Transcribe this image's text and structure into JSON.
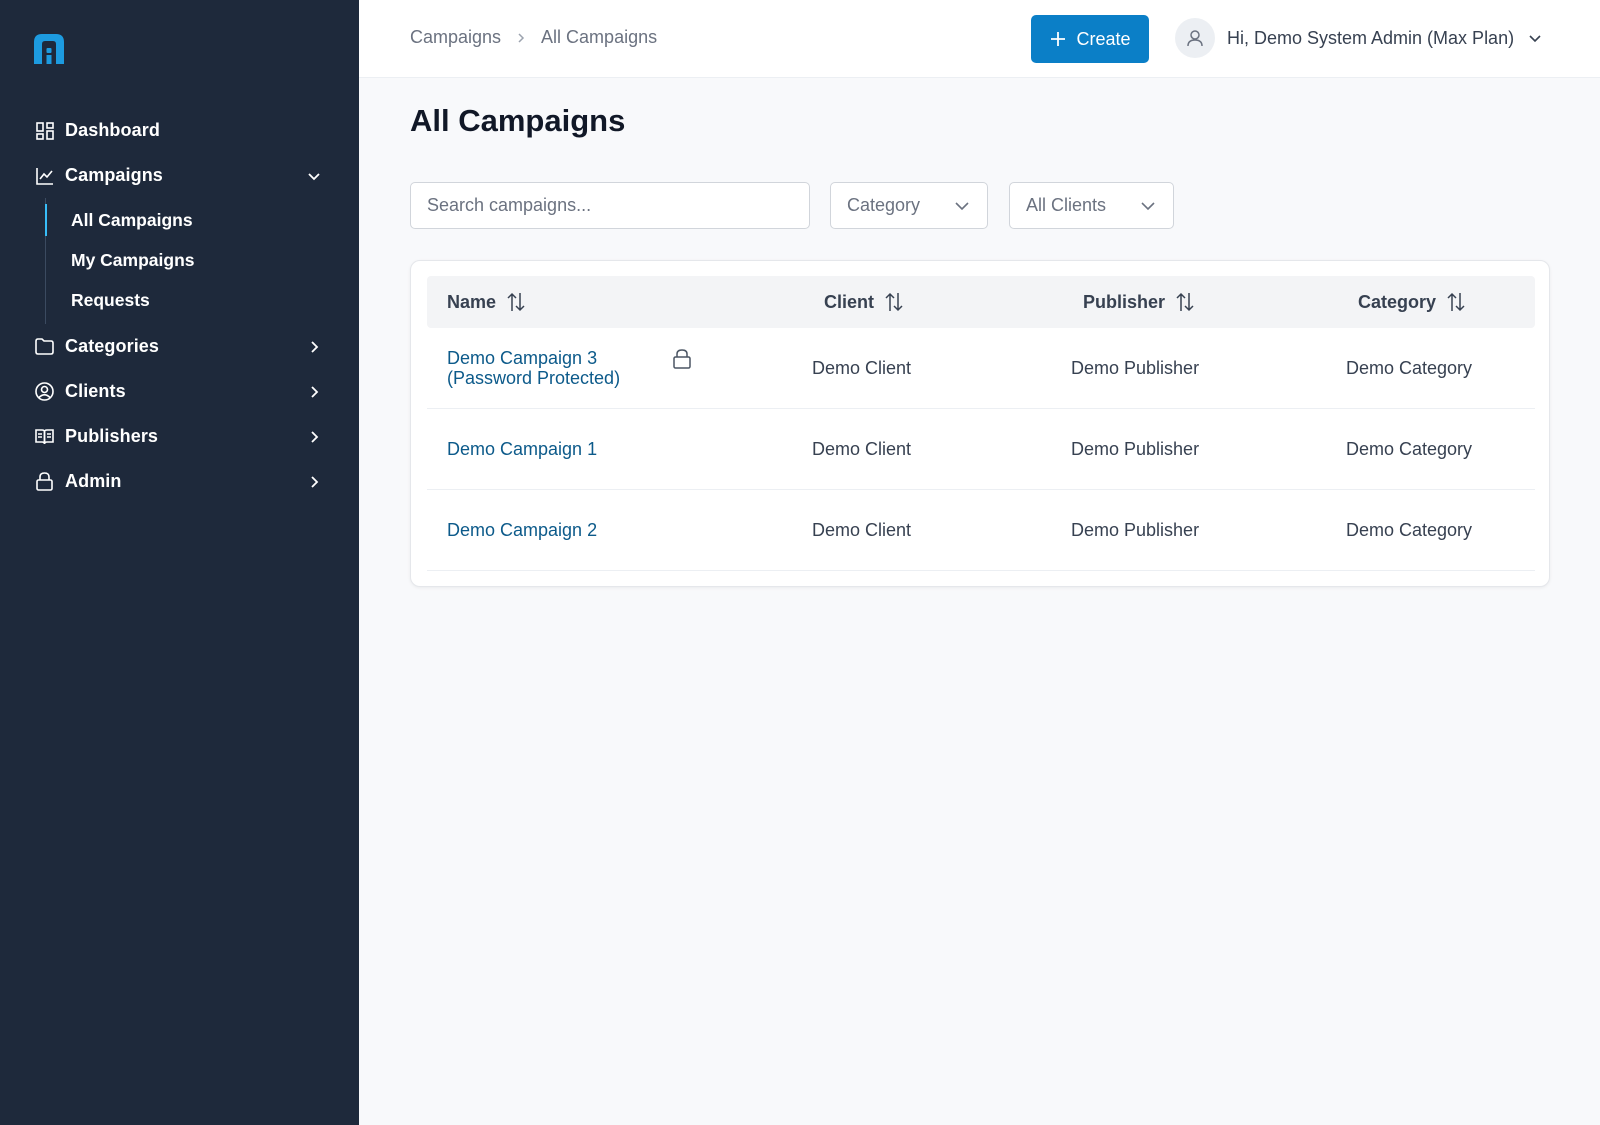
{
  "sidebar": {
    "items": [
      {
        "label": "Dashboard",
        "icon": "dashboard-icon"
      },
      {
        "label": "Campaigns",
        "icon": "chart-icon",
        "expanded": true,
        "children": [
          {
            "label": "All Campaigns",
            "active": true
          },
          {
            "label": "My Campaigns"
          },
          {
            "label": "Requests"
          }
        ]
      },
      {
        "label": "Categories",
        "icon": "folder-icon"
      },
      {
        "label": "Clients",
        "icon": "user-circle-icon"
      },
      {
        "label": "Publishers",
        "icon": "book-icon"
      },
      {
        "label": "Admin",
        "icon": "lock-icon"
      }
    ]
  },
  "header": {
    "breadcrumb": [
      "Campaigns",
      "All Campaigns"
    ],
    "create_label": "Create",
    "user_label": "Hi, Demo System Admin (Max Plan)"
  },
  "main": {
    "title": "All Campaigns",
    "search_placeholder": "Search campaigns...",
    "category_filter": "Category",
    "client_filter": "All Clients",
    "columns": [
      "Name",
      "Client",
      "Publisher",
      "Category"
    ],
    "rows": [
      {
        "name_line1": "Demo Campaign 3",
        "name_line2": "(Password Protected)",
        "locked": true,
        "client": "Demo Client",
        "publisher": "Demo Publisher",
        "category": "Demo Category"
      },
      {
        "name_line1": "Demo Campaign 1",
        "name_line2": "",
        "locked": false,
        "client": "Demo Client",
        "publisher": "Demo Publisher",
        "category": "Demo Category"
      },
      {
        "name_line1": "Demo Campaign 2",
        "name_line2": "",
        "locked": false,
        "client": "Demo Client",
        "publisher": "Demo Publisher",
        "category": "Demo Category"
      }
    ]
  },
  "colors": {
    "sidebar_bg": "#1e293b",
    "accent": "#0b7fc7",
    "link": "#0c5a8a",
    "logo": "#1d9be0"
  }
}
